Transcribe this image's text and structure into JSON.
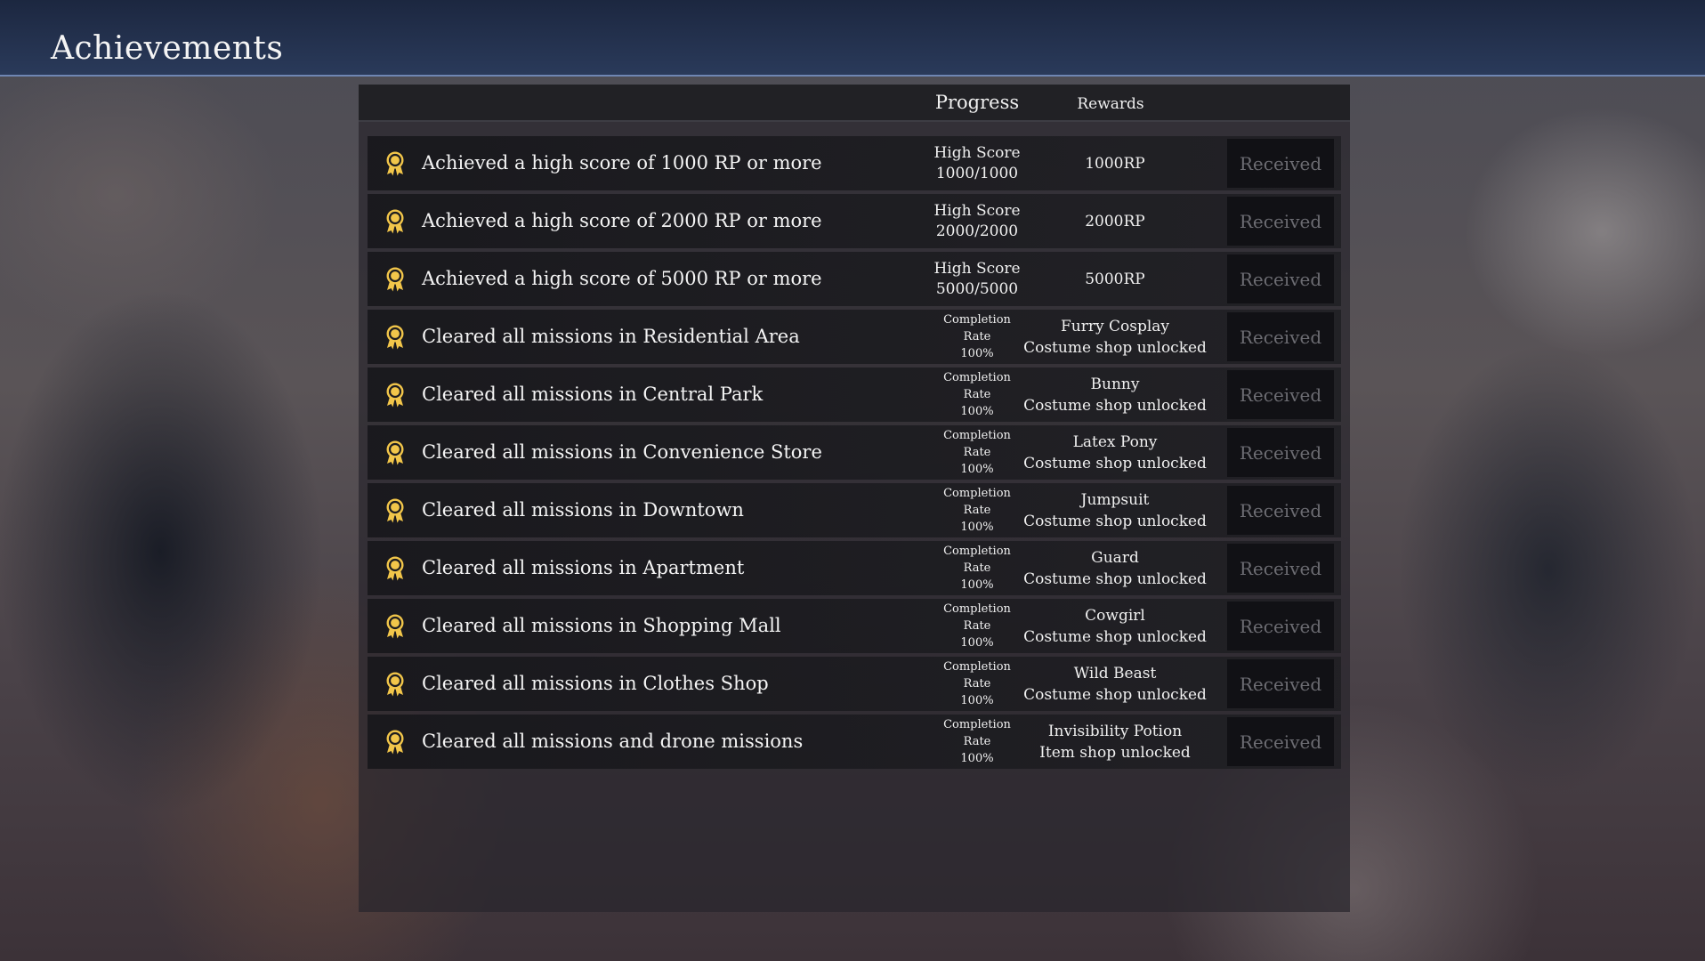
{
  "header": {
    "title": "Achievements"
  },
  "columns": {
    "progress": "Progress",
    "rewards": "Rewards"
  },
  "colors": {
    "medal": "#f2c64a",
    "topbar": "#223150",
    "status_text": "#6c6c72"
  },
  "achievements": [
    {
      "icon": "medal-icon",
      "title": "Achieved a high score of 1000 RP or more",
      "progress_lines": [
        "High Score",
        "1000/1000"
      ],
      "reward_lines": [
        "1000RP"
      ],
      "status": "Received"
    },
    {
      "icon": "medal-icon",
      "title": "Achieved a high score of 2000 RP or more",
      "progress_lines": [
        "High Score",
        "2000/2000"
      ],
      "reward_lines": [
        "2000RP"
      ],
      "status": "Received"
    },
    {
      "icon": "medal-icon",
      "title": "Achieved a high score of 5000 RP or more",
      "progress_lines": [
        "High Score",
        "5000/5000"
      ],
      "reward_lines": [
        "5000RP"
      ],
      "status": "Received"
    },
    {
      "icon": "medal-icon",
      "title": "Cleared all missions in Residential Area",
      "progress_lines": [
        "Completion",
        "Rate",
        "100%"
      ],
      "reward_lines": [
        "Furry Cosplay",
        "Costume shop unlocked"
      ],
      "status": "Received"
    },
    {
      "icon": "medal-icon",
      "title": "Cleared all missions in Central Park",
      "progress_lines": [
        "Completion",
        "Rate",
        "100%"
      ],
      "reward_lines": [
        "Bunny",
        "Costume shop unlocked"
      ],
      "status": "Received"
    },
    {
      "icon": "medal-icon",
      "title": "Cleared all missions in Convenience Store",
      "progress_lines": [
        "Completion",
        "Rate",
        "100%"
      ],
      "reward_lines": [
        "Latex Pony",
        "Costume shop unlocked"
      ],
      "status": "Received"
    },
    {
      "icon": "medal-icon",
      "title": "Cleared all missions in Downtown",
      "progress_lines": [
        "Completion",
        "Rate",
        "100%"
      ],
      "reward_lines": [
        "Jumpsuit",
        "Costume shop unlocked"
      ],
      "status": "Received"
    },
    {
      "icon": "medal-icon",
      "title": "Cleared all missions in Apartment",
      "progress_lines": [
        "Completion",
        "Rate",
        "100%"
      ],
      "reward_lines": [
        "Guard",
        "Costume shop unlocked"
      ],
      "status": "Received"
    },
    {
      "icon": "medal-icon",
      "title": "Cleared all missions in Shopping Mall",
      "progress_lines": [
        "Completion",
        "Rate",
        "100%"
      ],
      "reward_lines": [
        "Cowgirl",
        "Costume shop unlocked"
      ],
      "status": "Received"
    },
    {
      "icon": "medal-icon",
      "title": "Cleared all missions in Clothes Shop",
      "progress_lines": [
        "Completion",
        "Rate",
        "100%"
      ],
      "reward_lines": [
        "Wild Beast",
        "Costume shop unlocked"
      ],
      "status": "Received"
    },
    {
      "icon": "medal-icon",
      "title": "Cleared all missions and drone missions",
      "progress_lines": [
        "Completion",
        "Rate",
        "100%"
      ],
      "reward_lines": [
        "Invisibility Potion",
        "Item shop unlocked"
      ],
      "status": "Received"
    }
  ]
}
